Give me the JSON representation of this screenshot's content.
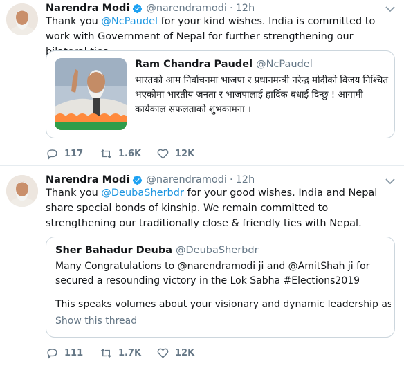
{
  "tweets": [
    {
      "author": "Narendra Modi",
      "handle": "@narendramodi",
      "dot": "·",
      "time": "12h",
      "text_parts": [
        "Thank you ",
        "@NcPaudel",
        " for your kind wishes. India is committed to work with Government of Nepal for further strengthening our bilateral ties."
      ],
      "quote": {
        "author": "Ram Chandra Paudel",
        "handle": "@NcPaudel",
        "text": "भारतको आम निर्वाचनमा भाजपा र प्रधानमन्त्री नरेन्द्र मोदीको विजय निश्चित भएकोमा भारतीय जनता र भाजपालाई हार्दिक बधाई दिन्छु ! आगामी कार्यकाल सफलताको शुभकामना ।"
      },
      "replies": "117",
      "retweets": "1.6K",
      "likes": "12K"
    },
    {
      "author": "Narendra Modi",
      "handle": "@narendramodi",
      "dot": "·",
      "time": "12h",
      "text_parts": [
        "Thank you ",
        "@DeubaSherbdr",
        " for your good wishes. India and Nepal share special bonds of kinship. We remain committed to strengthening our traditionally close & friendly ties with Nepal."
      ],
      "quote": {
        "author": "Sher Bahadur Deuba",
        "handle": "@DeubaSherbdr",
        "text": "Many Congratulations to @narendramodi ji and @AmitShah ji for secured a resounding victory in the Lok Sabha #Elections2019",
        "text2": "This speaks volumes about your visionary and dynamic leadership as well...",
        "show_thread": "Show this thread"
      },
      "replies": "111",
      "retweets": "1.7K",
      "likes": "12K"
    }
  ],
  "colors": {
    "link": "#1b95e0",
    "muted": "#657786",
    "border": "#ccd6dd",
    "verified": "#1da1f2"
  },
  "icons": [
    "verified-badge-icon",
    "chevron-down-icon",
    "reply-icon",
    "retweet-icon",
    "like-icon"
  ]
}
